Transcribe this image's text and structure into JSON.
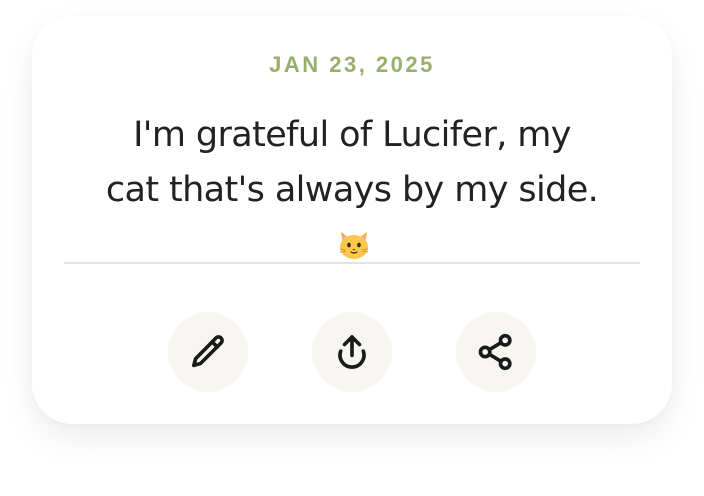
{
  "card": {
    "date": "JAN 23, 2025",
    "note_text": "I'm grateful of Lucifer, my cat that's always by my side.",
    "note_emoji": "cat-face-emoji"
  },
  "actions": [
    {
      "icon": "pencil-icon",
      "purpose": "edit"
    },
    {
      "icon": "upload-icon",
      "purpose": "upload"
    },
    {
      "icon": "share-icon",
      "purpose": "share"
    }
  ],
  "colors": {
    "date_accent": "#9aae6c",
    "text": "#222222",
    "button_bg": "#f7f6f2",
    "divider": "#e3e3e3",
    "icon": "#1a1a1a"
  }
}
